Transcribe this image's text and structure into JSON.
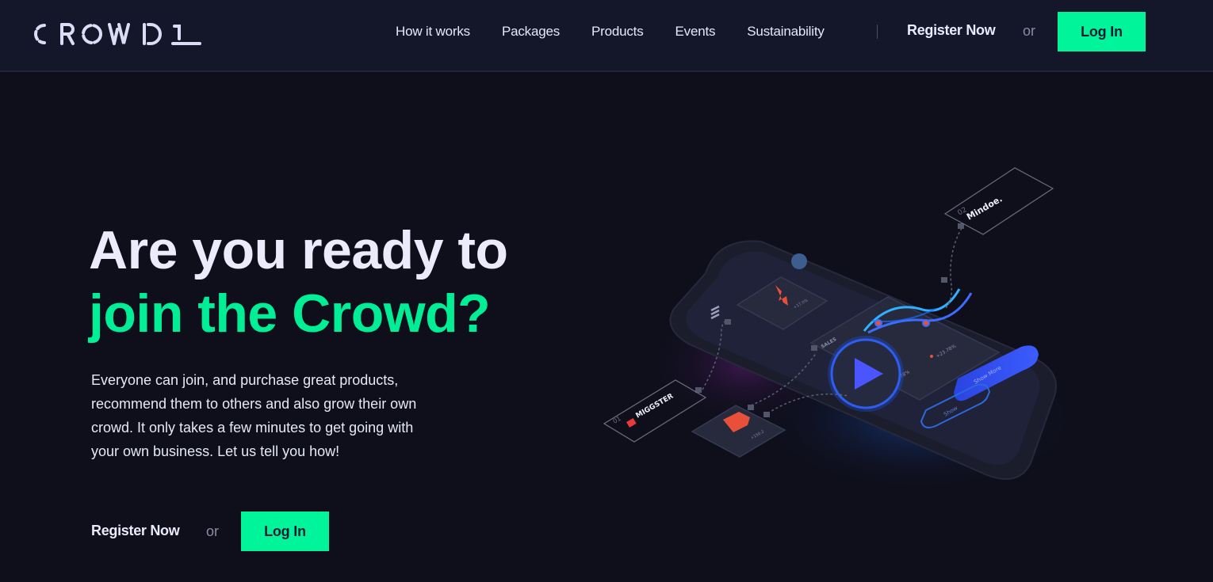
{
  "header": {
    "logo_text": "CROWD 1",
    "nav": [
      {
        "label": "How it works"
      },
      {
        "label": "Packages"
      },
      {
        "label": "Products"
      },
      {
        "label": "Events"
      },
      {
        "label": "Sustainability"
      }
    ],
    "register_label": "Register Now",
    "or_label": "or",
    "login_label": "Log In"
  },
  "hero": {
    "title_line1": "Are you ready to",
    "title_line2": "join the Crowd?",
    "description": "Everyone can join, and purchase great products, recommend them to others and also grow their own crowd. It only takes a few minutes to get going with your own business. Let us tell you how!",
    "register_label": "Register Now",
    "or_label": "or",
    "login_label": "Log In"
  },
  "illustration": {
    "play_icon": "play-icon",
    "partners": [
      {
        "number": "01",
        "name": "MIGGSTER"
      },
      {
        "number": "02",
        "name": "Mindoe."
      }
    ],
    "sales_label": "SALES",
    "stat_left": "13.78%",
    "stat_right": "+23.78%",
    "card_top_stat": "+17.0%",
    "card_bottom_stat": "+150.2",
    "button_show_more": "Show More",
    "button_show": "Show"
  },
  "colors": {
    "accent": "#00f59b",
    "background": "#0f0f1c",
    "header_bg": "#14172a",
    "play_blue": "#4b55ff"
  }
}
